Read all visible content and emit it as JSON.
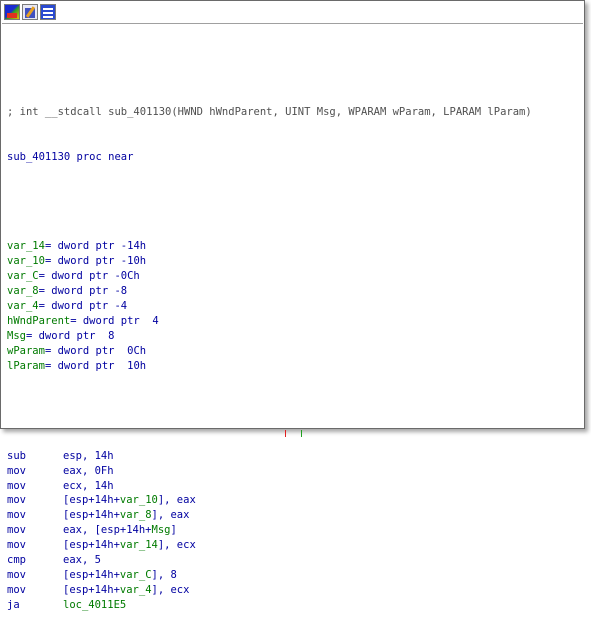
{
  "toolbar": {
    "buttons": [
      {
        "name": "graph-view-icon"
      },
      {
        "name": "edit-icon"
      },
      {
        "name": "text-view-icon"
      }
    ]
  },
  "comment": "; int __stdcall sub_401130(HWND hWndParent, UINT Msg, WPARAM wParam, LPARAM lParam)",
  "proc_line": "sub_401130 proc near",
  "vars": [
    {
      "name": "var_14",
      "def": "= dword ptr -14h"
    },
    {
      "name": "var_10",
      "def": "= dword ptr -10h"
    },
    {
      "name": "var_C",
      "def": "= dword ptr -0Ch"
    },
    {
      "name": "var_8",
      "def": "= dword ptr -8"
    },
    {
      "name": "var_4",
      "def": "= dword ptr -4"
    },
    {
      "name": "hWndParent",
      "def": "= dword ptr  4"
    },
    {
      "name": "Msg",
      "def": "= dword ptr  8"
    },
    {
      "name": "wParam",
      "def": "= dword ptr  0Ch"
    },
    {
      "name": "lParam",
      "def": "= dword ptr  10h"
    }
  ],
  "instructions": [
    {
      "mnem": "sub",
      "ops": "esp, 14h"
    },
    {
      "mnem": "mov",
      "ops": "eax, 0Fh"
    },
    {
      "mnem": "mov",
      "ops": "ecx, 14h"
    },
    {
      "mnem": "mov",
      "ops": "[esp+14h+var_10], eax"
    },
    {
      "mnem": "mov",
      "ops": "[esp+14h+var_8], eax"
    },
    {
      "mnem": "mov",
      "ops": "eax, [esp+14h+Msg]"
    },
    {
      "mnem": "mov",
      "ops": "[esp+14h+var_14], ecx"
    },
    {
      "mnem": "cmp",
      "ops": "eax, 5"
    },
    {
      "mnem": "mov",
      "ops": "[esp+14h+var_C], 8"
    },
    {
      "mnem": "mov",
      "ops": "[esp+14h+var_4], ecx"
    },
    {
      "mnem": "ja",
      "ops": "loc_4011E5"
    }
  ],
  "colors": {
    "code": "#0000a0",
    "identifier": "#007a00",
    "comment": "#505050",
    "edge_red": "#e02020",
    "edge_green": "#20a020"
  }
}
